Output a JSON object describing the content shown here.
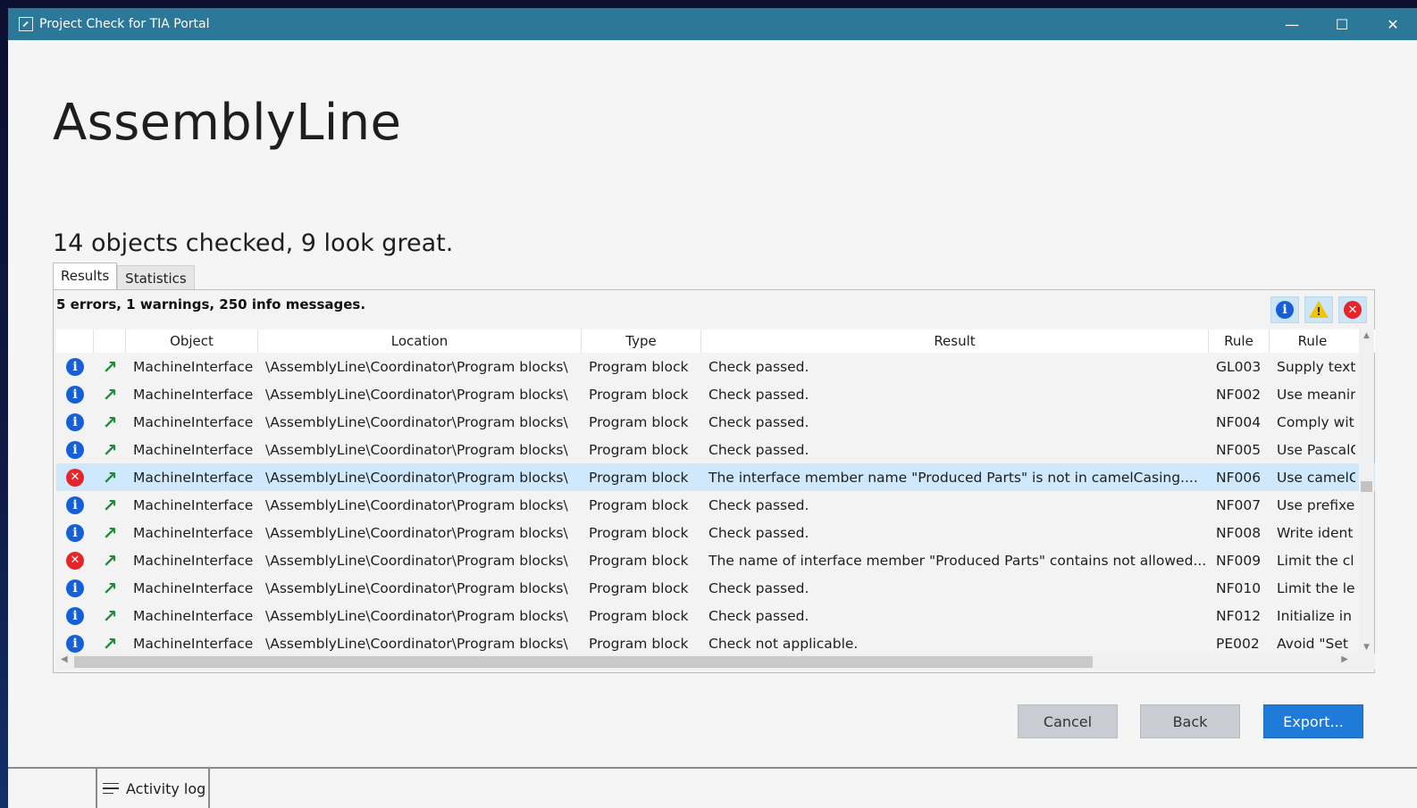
{
  "window": {
    "title": "Project Check for TIA Portal"
  },
  "window_controls": {
    "minimize": "—",
    "maximize": "☐",
    "close": "✕"
  },
  "heading": "AssemblyLine",
  "summary": "14 objects checked, 9 look great.",
  "tabs": [
    {
      "label": "Results"
    },
    {
      "label": "Statistics"
    }
  ],
  "message_summary": "5 errors, 1 warnings, 250 info messages.",
  "filters": {
    "info_icon": "info-icon",
    "warning_icon": "warning-icon",
    "error_icon": "error-icon"
  },
  "columns": {
    "object": "Object",
    "location": "Location",
    "type": "Type",
    "result": "Result",
    "rule": "Rule",
    "rule_desc": "Rule"
  },
  "rows": [
    {
      "severity": "info",
      "object": "MachineInterface",
      "location": "\\AssemblyLine\\Coordinator\\Program blocks\\",
      "type": "Program block",
      "result": "Check passed.",
      "rule": "GL003",
      "rule_desc": "Supply text"
    },
    {
      "severity": "info",
      "object": "MachineInterface",
      "location": "\\AssemblyLine\\Coordinator\\Program blocks\\",
      "type": "Program block",
      "result": "Check passed.",
      "rule": "NF002",
      "rule_desc": "Use meanir"
    },
    {
      "severity": "info",
      "object": "MachineInterface",
      "location": "\\AssemblyLine\\Coordinator\\Program blocks\\",
      "type": "Program block",
      "result": "Check passed.",
      "rule": "NF004",
      "rule_desc": "Comply wit"
    },
    {
      "severity": "info",
      "object": "MachineInterface",
      "location": "\\AssemblyLine\\Coordinator\\Program blocks\\",
      "type": "Program block",
      "result": "Check passed.",
      "rule": "NF005",
      "rule_desc": "Use PascalC"
    },
    {
      "severity": "error",
      "object": "MachineInterface",
      "location": "\\AssemblyLine\\Coordinator\\Program blocks\\",
      "type": "Program block",
      "result": "The interface member name \"Produced Parts\" is not in camelCasing....",
      "rule": "NF006",
      "rule_desc": "Use camelC"
    },
    {
      "severity": "info",
      "object": "MachineInterface",
      "location": "\\AssemblyLine\\Coordinator\\Program blocks\\",
      "type": "Program block",
      "result": "Check passed.",
      "rule": "NF007",
      "rule_desc": "Use prefixe"
    },
    {
      "severity": "info",
      "object": "MachineInterface",
      "location": "\\AssemblyLine\\Coordinator\\Program blocks\\",
      "type": "Program block",
      "result": "Check passed.",
      "rule": "NF008",
      "rule_desc": "Write ident"
    },
    {
      "severity": "error",
      "object": "MachineInterface",
      "location": "\\AssemblyLine\\Coordinator\\Program blocks\\",
      "type": "Program block",
      "result": "The name of interface member \"Produced Parts\" contains not allowed...",
      "rule": "NF009",
      "rule_desc": "Limit the cl"
    },
    {
      "severity": "info",
      "object": "MachineInterface",
      "location": "\\AssemblyLine\\Coordinator\\Program blocks\\",
      "type": "Program block",
      "result": "Check passed.",
      "rule": "NF010",
      "rule_desc": "Limit the le"
    },
    {
      "severity": "info",
      "object": "MachineInterface",
      "location": "\\AssemblyLine\\Coordinator\\Program blocks\\",
      "type": "Program block",
      "result": "Check passed.",
      "rule": "NF012",
      "rule_desc": "Initialize in"
    },
    {
      "severity": "info",
      "object": "MachineInterface",
      "location": "\\AssemblyLine\\Coordinator\\Program blocks\\",
      "type": "Program block",
      "result": "Check not applicable.",
      "rule": "PE002",
      "rule_desc": "Avoid \"Set"
    }
  ],
  "selected_row": 4,
  "buttons": {
    "cancel": "Cancel",
    "back": "Back",
    "export": "Export..."
  },
  "footer": {
    "activity_log": "Activity log"
  },
  "colors": {
    "titlebar": "#2c7898",
    "accent": "#1f7ad8",
    "selected_row": "#cfe8fb",
    "info": "#1560d8",
    "error": "#e5252a",
    "warning": "#f3c400",
    "navigate": "#1e8a3a"
  }
}
